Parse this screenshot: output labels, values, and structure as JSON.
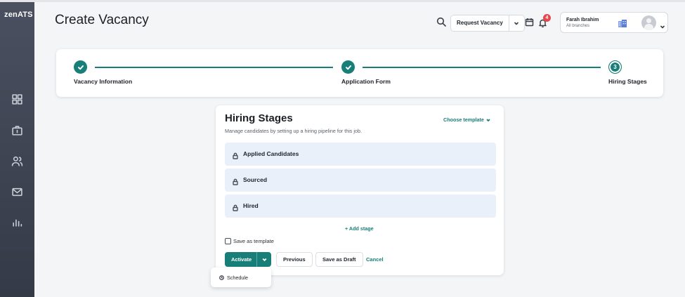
{
  "brand": {
    "logo_main": "zen",
    "logo_suffix": "ATS"
  },
  "sidebar": {
    "items": [
      {
        "icon": "grid-icon"
      },
      {
        "icon": "briefcase-icon"
      },
      {
        "icon": "users-icon"
      },
      {
        "icon": "mail-icon"
      },
      {
        "icon": "bar-chart-icon"
      }
    ]
  },
  "header": {
    "title": "Create Vacancy",
    "request_button_label": "Request Vacancy",
    "notification_count": "4",
    "user": {
      "name": "Farah Ibrahim",
      "branch": "All branches"
    }
  },
  "stepper": {
    "steps": [
      {
        "label": "Vacancy Information",
        "state": "done"
      },
      {
        "label": "Application Form",
        "state": "done"
      },
      {
        "label": "Hiring Stages",
        "state": "current",
        "number": "3"
      }
    ]
  },
  "hiring": {
    "title": "Hiring Stages",
    "subtitle": "Manage candidates by setting up a hiring pipeline for this job.",
    "choose_template": "Choose template",
    "stages": [
      {
        "label": "Applied Candidates"
      },
      {
        "label": "Sourced"
      },
      {
        "label": "Hired"
      }
    ],
    "add_stage": "+ Add stage",
    "save_template_label": "Save as template",
    "save_template_checked": false,
    "activate_label": "Activate",
    "previous_label": "Previous",
    "save_draft_label": "Save as Draft",
    "cancel_label": "Cancel"
  },
  "dropdown": {
    "schedule_label": "Schedule"
  },
  "colors": {
    "accent": "#177e78",
    "sidebar": "#3e4352",
    "stage_bg": "#eaf0fa",
    "badge": "#e5484d"
  }
}
